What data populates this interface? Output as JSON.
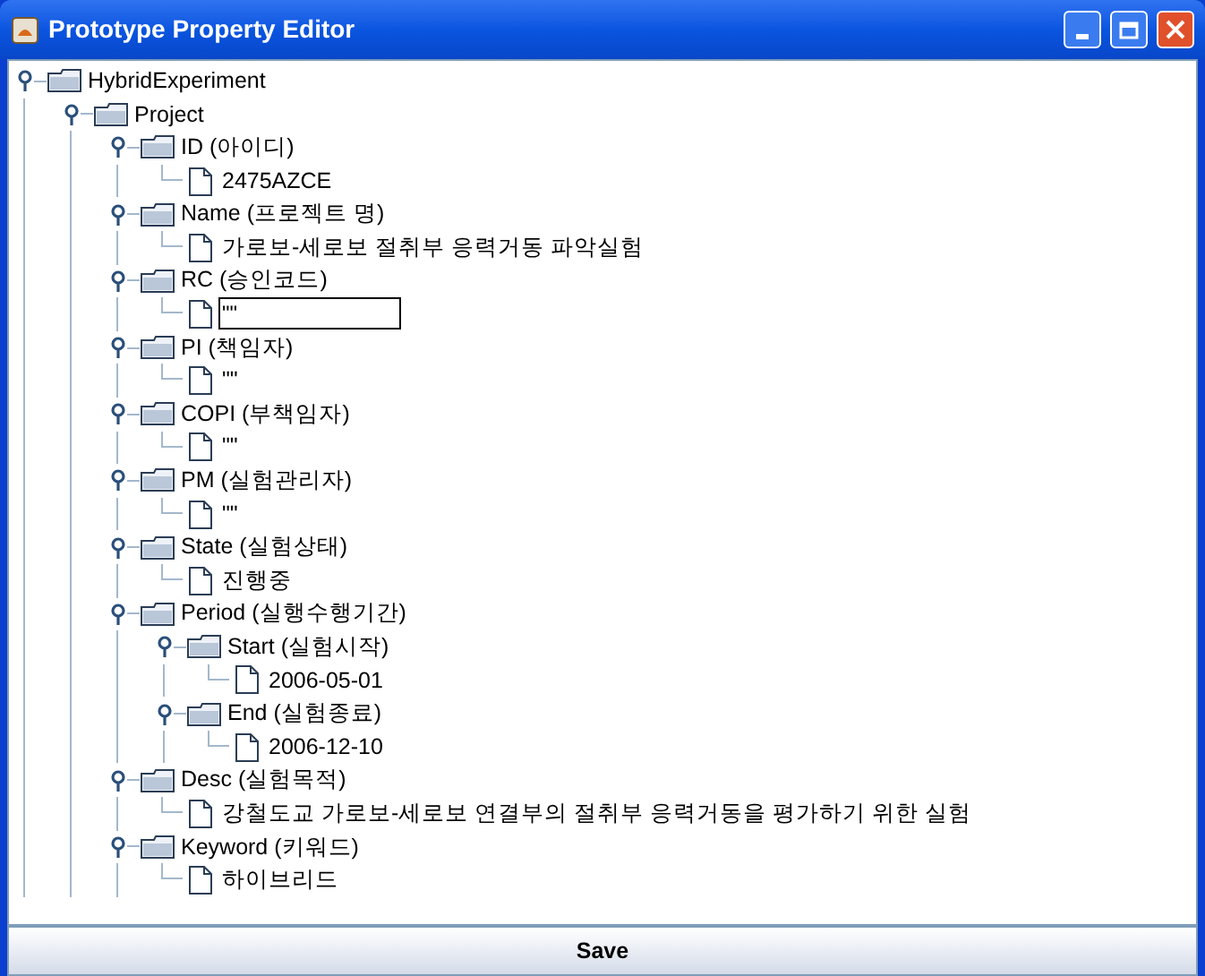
{
  "window": {
    "title": "Prototype Property Editor"
  },
  "tree": [
    {
      "label": "HybridExperiment",
      "expanded": true,
      "children": [
        {
          "label": "Project",
          "expanded": true,
          "children": [
            {
              "label": "ID (아이디)",
              "expanded": true,
              "children": [
                {
                  "label": "2475AZCE",
                  "kind": "leaf"
                }
              ]
            },
            {
              "label": "Name (프로젝트 명)",
              "expanded": true,
              "children": [
                {
                  "label": "가로보-세로보 절취부 응력거동 파악실험",
                  "kind": "leaf"
                }
              ]
            },
            {
              "label": "RC (승인코드)",
              "expanded": true,
              "children": [
                {
                  "label": "\"\"",
                  "kind": "editing"
                }
              ]
            },
            {
              "label": "PI (책임자)",
              "expanded": true,
              "children": [
                {
                  "label": "\"\"",
                  "kind": "leaf"
                }
              ]
            },
            {
              "label": "COPI (부책임자)",
              "expanded": true,
              "children": [
                {
                  "label": "\"\"",
                  "kind": "leaf"
                }
              ]
            },
            {
              "label": "PM (실험관리자)",
              "expanded": true,
              "children": [
                {
                  "label": "\"\"",
                  "kind": "leaf"
                }
              ]
            },
            {
              "label": "State (실험상태)",
              "expanded": true,
              "children": [
                {
                  "label": "진행중",
                  "kind": "leaf"
                }
              ]
            },
            {
              "label": "Period (실행수행기간)",
              "expanded": true,
              "children": [
                {
                  "label": "Start (실험시작)",
                  "expanded": true,
                  "children": [
                    {
                      "label": "2006-05-01",
                      "kind": "leaf"
                    }
                  ]
                },
                {
                  "label": "End (실험종료)",
                  "expanded": true,
                  "children": [
                    {
                      "label": "2006-12-10",
                      "kind": "leaf"
                    }
                  ]
                }
              ]
            },
            {
              "label": "Desc (실험목적)",
              "expanded": true,
              "children": [
                {
                  "label": "강철도교 가로보-세로보 연결부의 절취부 응력거동을 평가하기 위한 실험",
                  "kind": "leaf"
                }
              ]
            },
            {
              "label": "Keyword (키워드)",
              "expanded": true,
              "children": [
                {
                  "label": "하이브리드",
                  "kind": "leaf"
                }
              ]
            }
          ]
        }
      ]
    }
  ],
  "buttons": [
    {
      "label": "Save"
    }
  ]
}
